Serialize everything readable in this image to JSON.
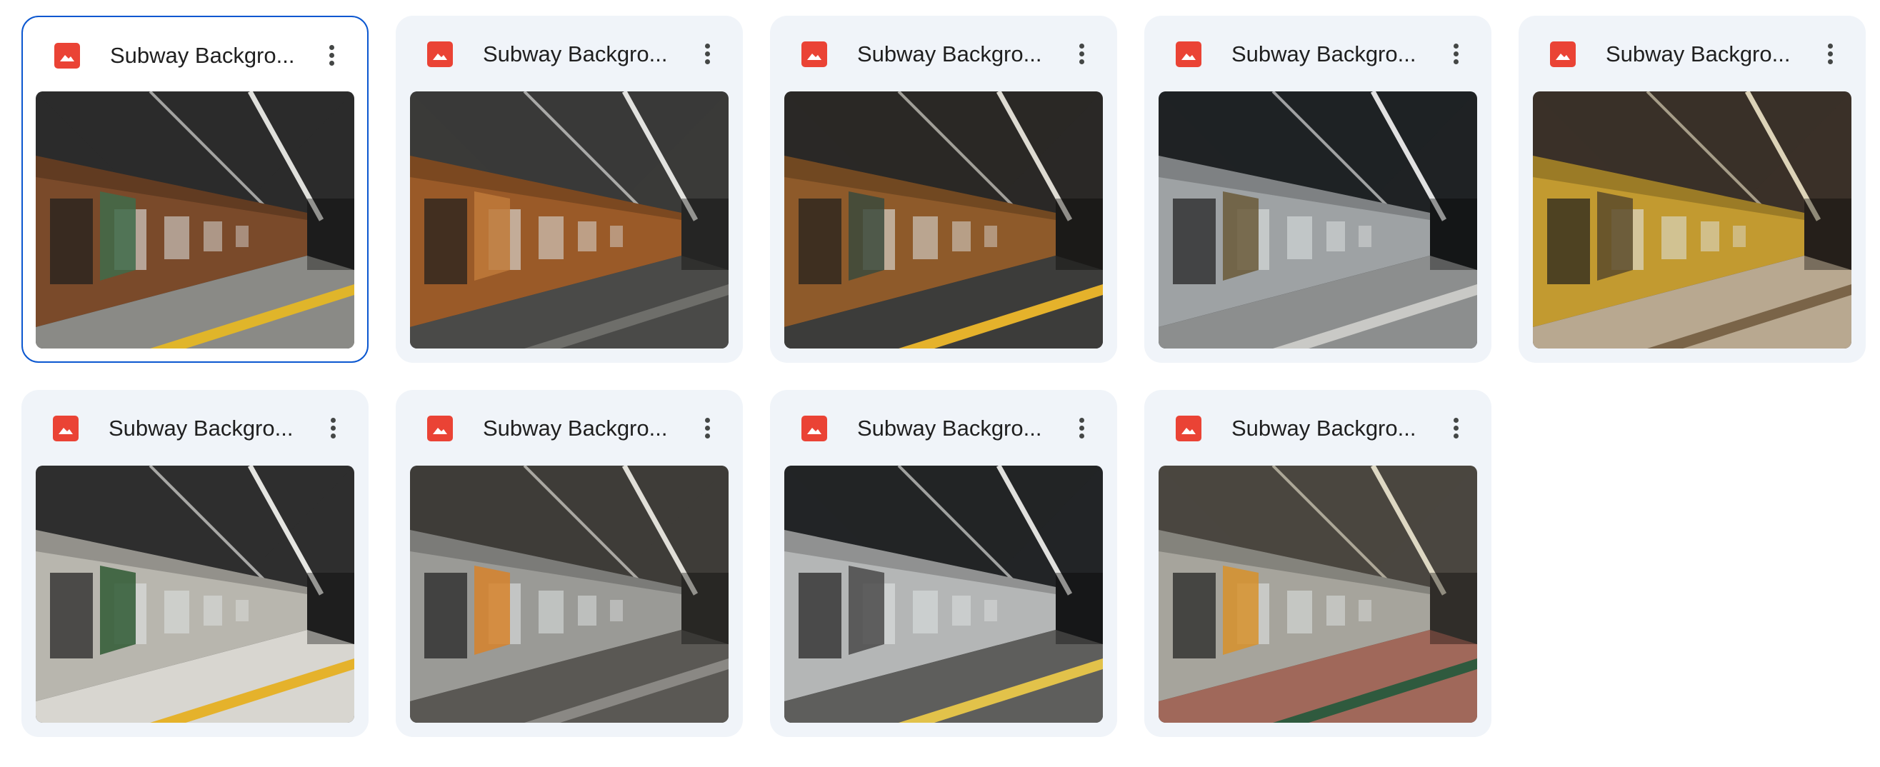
{
  "files": [
    {
      "name": "Subway Backgro...",
      "selected": true,
      "icon": "image-icon",
      "theme": "rust-green"
    },
    {
      "name": "Subway Backgro...",
      "selected": false,
      "icon": "image-icon",
      "theme": "copper-interior"
    },
    {
      "name": "Subway Backgro...",
      "selected": false,
      "icon": "image-icon",
      "theme": "copper-platform"
    },
    {
      "name": "Subway Backgro...",
      "selected": false,
      "icon": "image-icon",
      "theme": "silver-platform"
    },
    {
      "name": "Subway Backgro...",
      "selected": false,
      "icon": "image-icon",
      "theme": "yellow-tile"
    },
    {
      "name": "Subway Backgro...",
      "selected": false,
      "icon": "image-icon",
      "theme": "green-tile"
    },
    {
      "name": "Subway Backgro...",
      "selected": false,
      "icon": "image-icon",
      "theme": "orange-seats"
    },
    {
      "name": "Subway Backgro...",
      "selected": false,
      "icon": "image-icon",
      "theme": "grey-station"
    },
    {
      "name": "Subway Backgro...",
      "selected": false,
      "icon": "image-icon",
      "theme": "tiled-wall-bench"
    }
  ],
  "colors": {
    "card_bg": "#f0f4f9",
    "selected_border": "#0b57d0",
    "image_icon": "#ea4335",
    "title_text": "#1f1f1f",
    "more_icon": "#444746"
  }
}
